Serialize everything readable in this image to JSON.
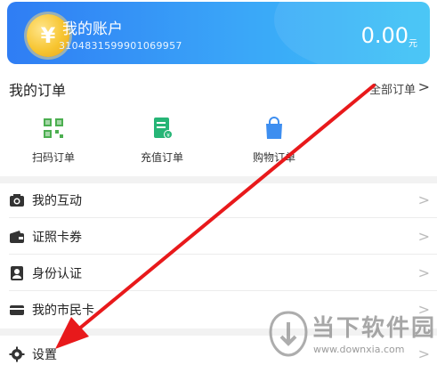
{
  "account": {
    "title": "我的账户",
    "number": "3104831599901069957",
    "balance": "0.00",
    "unit": "元",
    "coin_symbol": "¥"
  },
  "orders": {
    "title": "我的订单",
    "all_label": "全部订单",
    "chevron": ">",
    "items": [
      {
        "label": "扫码订单",
        "icon": "qr-scan-icon",
        "color": "#4caf50"
      },
      {
        "label": "充值订单",
        "icon": "recharge-doc-icon",
        "color": "#26b576"
      },
      {
        "label": "购物订单",
        "icon": "shopping-bag-icon",
        "color": "#3d8ef0"
      }
    ]
  },
  "menu": [
    {
      "label": "我的互动",
      "icon": "camera-icon"
    },
    {
      "label": "证照卡券",
      "icon": "wallet-icon"
    },
    {
      "label": "身份认证",
      "icon": "id-badge-icon"
    },
    {
      "label": "我的市民卡",
      "icon": "card-icon"
    },
    {
      "label": "设置",
      "icon": "gear-icon"
    }
  ],
  "chevron": ">",
  "watermark": {
    "name": "当下软件园",
    "url": "www.downxia.com"
  },
  "colors": {
    "card_gradient_start": "#2f7df4",
    "card_gradient_end": "#3cc3f6",
    "annotation_arrow": "#e8191b"
  }
}
